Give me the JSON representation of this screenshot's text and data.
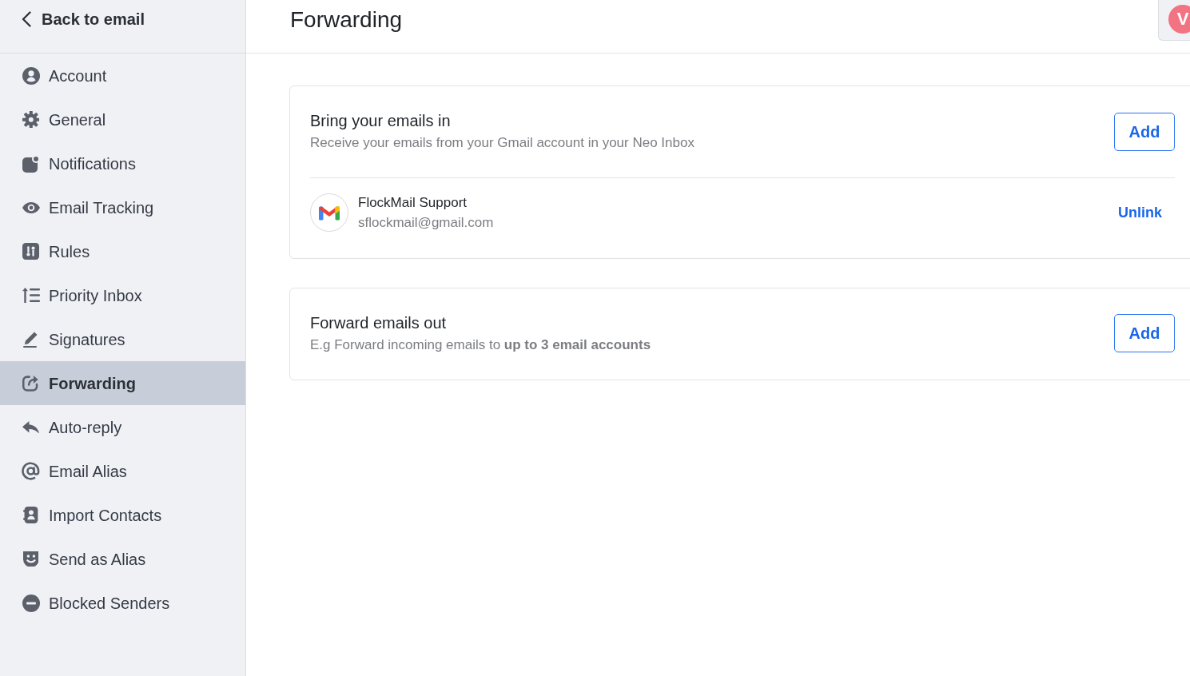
{
  "sidebar": {
    "back_link": {
      "label": "Back to email"
    },
    "items": [
      {
        "label": "Account",
        "selected": false
      },
      {
        "label": "General",
        "selected": false
      },
      {
        "label": "Notifications",
        "selected": false
      },
      {
        "label": "Email Tracking",
        "selected": false
      },
      {
        "label": "Rules",
        "selected": false
      },
      {
        "label": "Priority Inbox",
        "selected": false
      },
      {
        "label": "Signatures",
        "selected": false
      },
      {
        "label": "Forwarding",
        "selected": true
      },
      {
        "label": "Auto-reply",
        "selected": false
      },
      {
        "label": "Email Alias",
        "selected": false
      },
      {
        "label": "Import Contacts",
        "selected": false
      },
      {
        "label": "Send as Alias",
        "selected": false
      },
      {
        "label": "Blocked Senders",
        "selected": false
      }
    ]
  },
  "header": {
    "title": "Forwarding",
    "avatar": {
      "initial": "V"
    }
  },
  "sections": [
    {
      "title": "Bring your emails in",
      "description": "Receive your emails from your Gmail account in your Neo Inbox",
      "button": "Add",
      "accounts": [
        {
          "name": "FlockMail Support",
          "email": "sflockmail@gmail.com",
          "action": "Unlink"
        }
      ]
    },
    {
      "title": "Forward emails out",
      "description": "E.g Forward incoming emails to **up to 3 email accounts**",
      "button": "Add"
    }
  ]
}
